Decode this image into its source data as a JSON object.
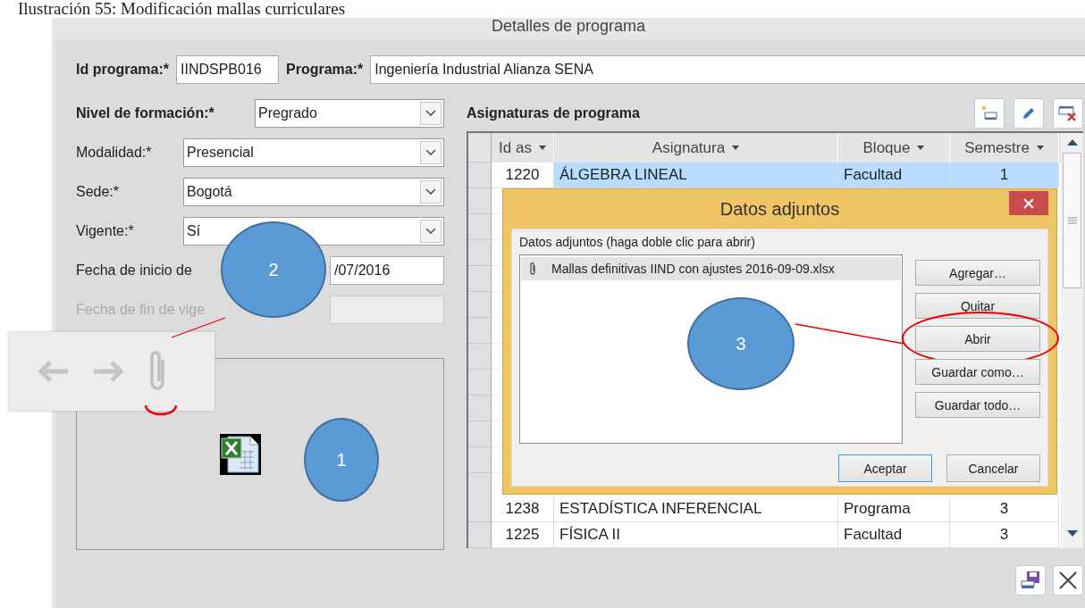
{
  "caption": "Ilustración 55: Modificación mallas curriculares",
  "window": {
    "title": "Detalles de programa"
  },
  "header_fields": [
    {
      "label": "Id programa:*",
      "value": "IINDSPB016"
    },
    {
      "label": "Programa:*",
      "value": "Ingeniería Industrial Alianza SENA"
    }
  ],
  "fields": [
    {
      "kind": "combo",
      "label": "Nivel de formación:*",
      "value": "Pregrado",
      "bold": true,
      "disabled": false
    },
    {
      "kind": "combo",
      "label": "Modalidad:*",
      "value": "Presencial",
      "bold": false,
      "disabled": false
    },
    {
      "kind": "combo",
      "label": "Sede:*",
      "value": "Bogotá",
      "bold": false,
      "disabled": false
    },
    {
      "kind": "combo",
      "label": "Vigente:*",
      "value": "Sí",
      "bold": false,
      "disabled": false
    },
    {
      "kind": "text",
      "label": "Fecha de inicio de",
      "value": "/07/2016",
      "bold": false,
      "disabled": false
    },
    {
      "kind": "text",
      "label": "Fecha de fin de vige",
      "bold": false,
      "disabled": true
    }
  ],
  "subjects": {
    "title": "Asignaturas de programa",
    "columns": [
      "Id as",
      "Asignatura",
      "Bloque",
      "Semestre"
    ],
    "rows": [
      {
        "id": "1220",
        "asignatura": "ÁLGEBRA LINEAL",
        "bloque": "Facultad",
        "semestre": "1",
        "selected": true
      },
      {
        "id": "1238",
        "asignatura": "ESTADÍSTICA INFERENCIAL",
        "bloque": "Programa",
        "semestre": "3",
        "selected": false
      },
      {
        "id": "1225",
        "asignatura": "FÍSICA II",
        "bloque": "Facultad",
        "semestre": "3",
        "selected": false
      }
    ]
  },
  "dialog": {
    "title": "Datos adjuntos",
    "list_label": "Datos adjuntos (haga doble clic para abrir)",
    "files": [
      {
        "name": "Mallas definitivas IIND con ajustes 2016-09-09.xlsx",
        "selected": true
      }
    ],
    "side_buttons": [
      {
        "label": "Agregar…",
        "highlighted": false
      },
      {
        "label": "Quitar",
        "highlighted": false
      },
      {
        "label": "Abrir",
        "highlighted": true
      },
      {
        "label": "Guardar como…",
        "highlighted": false
      },
      {
        "label": "Guardar todo…",
        "highlighted": false
      }
    ],
    "footer_buttons": [
      {
        "label": "Aceptar",
        "default": true
      },
      {
        "label": "Cancelar",
        "default": false
      }
    ]
  },
  "annotations": [
    {
      "label": "2"
    },
    {
      "label": "1"
    },
    {
      "label": "3"
    }
  ]
}
